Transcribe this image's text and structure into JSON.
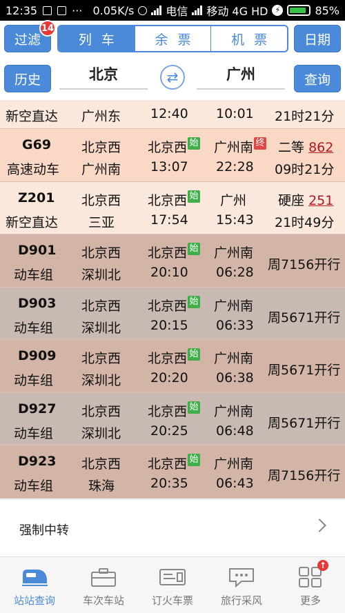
{
  "status_bar": {
    "time": "12:35",
    "speed": "0.05K/s",
    "carrier1": "电信",
    "carrier2": "移动 4G HD",
    "battery": "85%"
  },
  "toolbar": {
    "filter_label": "过滤",
    "filter_badge": "14",
    "tabs": [
      {
        "label": "列车",
        "active": true
      },
      {
        "label": "余票",
        "active": false
      },
      {
        "label": "机票",
        "active": false
      }
    ],
    "date_label": "日期",
    "history_label": "历史",
    "from_station": "北京",
    "to_station": "广州",
    "query_label": "查询",
    "swap_icon": "swap-arrows"
  },
  "trains": [
    {
      "line1": "新空直达",
      "from": "广州东",
      "dep": "12:40",
      "arr": "10:01",
      "info": "21时21分"
    },
    {
      "code": "G69",
      "type": "高速动车",
      "from": "北京西",
      "to": "广州南",
      "dep_station": "北京西",
      "dep_tag": "始",
      "dep": "13:07",
      "arr_station": "广州南",
      "arr_tag": "终",
      "arr": "22:28",
      "seat": "二等",
      "seat_count": "862",
      "duration": "09时21分"
    },
    {
      "code": "Z201",
      "type": "新空直达",
      "from": "北京西",
      "to": "三亚",
      "dep_station": "北京西",
      "dep_tag": "始",
      "dep": "17:54",
      "arr_station": "广州",
      "arr": "15:43",
      "seat": "硬座",
      "seat_count": "251",
      "duration": "21时49分"
    },
    {
      "code": "D901",
      "type": "动车组",
      "from": "北京西",
      "to": "深圳北",
      "dep_station": "北京西",
      "dep_tag": "始",
      "dep": "20:10",
      "arr_station": "广州南",
      "arr": "06:28",
      "schedule": "周7156开行"
    },
    {
      "code": "D903",
      "type": "动车组",
      "from": "北京西",
      "to": "深圳北",
      "dep_station": "北京西",
      "dep_tag": "始",
      "dep": "20:15",
      "arr_station": "广州南",
      "arr": "06:33",
      "schedule": "周5671开行"
    },
    {
      "code": "D909",
      "type": "动车组",
      "from": "北京西",
      "to": "深圳北",
      "dep_station": "北京西",
      "dep_tag": "始",
      "dep": "20:20",
      "arr_station": "广州南",
      "arr": "06:38",
      "schedule": "周5671开行"
    },
    {
      "code": "D927",
      "type": "动车组",
      "from": "北京西",
      "to": "深圳北",
      "dep_station": "北京西",
      "dep_tag": "始",
      "dep": "20:25",
      "arr_station": "广州南",
      "arr": "06:48",
      "schedule": "周5671开行"
    },
    {
      "code": "D923",
      "type": "动车组",
      "from": "北京西",
      "to": "珠海",
      "dep_station": "北京西",
      "dep_tag": "始",
      "dep": "20:35",
      "arr_station": "广州南",
      "arr": "06:43",
      "schedule": "周7156开行"
    }
  ],
  "transfer": {
    "label": "强制中转"
  },
  "nav": [
    {
      "label": "站站查询",
      "icon": "train-icon",
      "active": true
    },
    {
      "label": "车次车站",
      "icon": "briefcase-icon",
      "active": false
    },
    {
      "label": "订火车票",
      "icon": "ticket-icon",
      "active": false
    },
    {
      "label": "旅行采风",
      "icon": "chat-icon",
      "active": false
    },
    {
      "label": "更多",
      "icon": "grid-icon",
      "active": false,
      "badge": "↑"
    }
  ],
  "colors": {
    "accent": "#4a8ad9",
    "start_tag": "#3fae49",
    "end_tag": "#e04848",
    "count": "#b01820"
  }
}
